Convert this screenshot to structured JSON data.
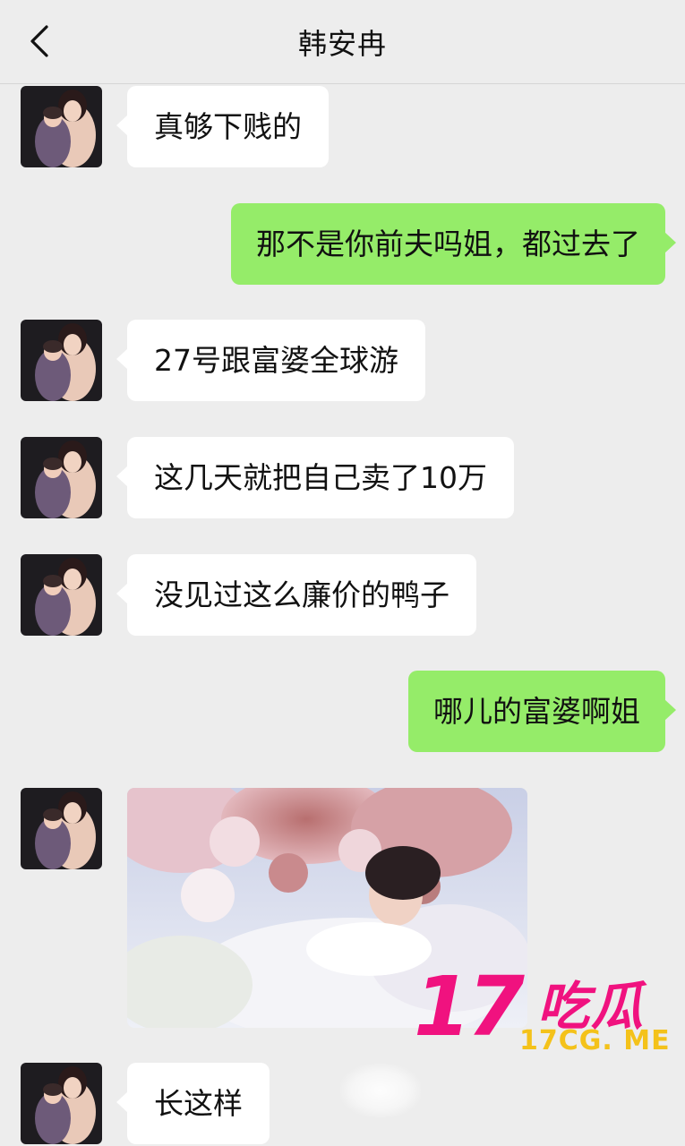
{
  "header": {
    "title": "韩安冉",
    "back_icon": "chevron-left-icon"
  },
  "messages": [
    {
      "side": "in",
      "text": "真够下贱的"
    },
    {
      "side": "out",
      "text": "那不是你前夫吗姐，都过去了"
    },
    {
      "side": "in",
      "text": "27号跟富婆全球游"
    },
    {
      "side": "in",
      "text": "这几天就把自己卖了10万"
    },
    {
      "side": "in",
      "text": "没见过这么廉价的鸭子"
    },
    {
      "side": "out",
      "text": "哪儿的富婆啊姐"
    },
    {
      "side": "in",
      "type": "image",
      "description": "photo-of-woman-in-white-dress-among-flowers"
    },
    {
      "side": "in",
      "text": "长这样"
    }
  ],
  "watermark": {
    "number": "17",
    "chinese": "吃瓜",
    "url": "17CG. ME"
  },
  "colors": {
    "background": "#ededed",
    "incoming_bubble": "#ffffff",
    "outgoing_bubble": "#95ec69",
    "watermark_pink": "#f0127f",
    "watermark_yellow": "#f4c21a"
  }
}
